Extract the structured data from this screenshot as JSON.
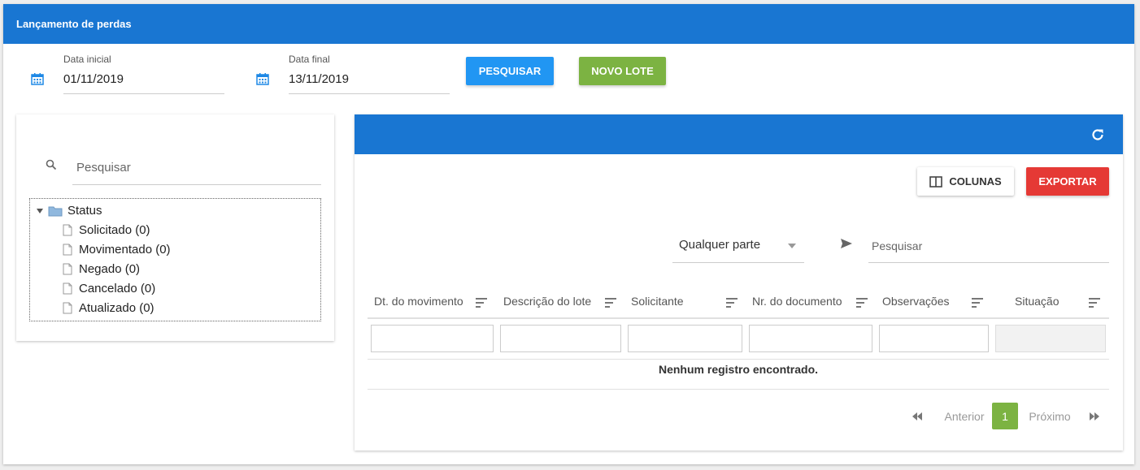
{
  "title": "Lançamento de perdas",
  "date_start": {
    "label": "Data inicial",
    "value": "01/11/2019",
    "icon": "calendar-icon"
  },
  "date_end": {
    "label": "Data final",
    "value": "13/11/2019",
    "icon": "calendar-icon"
  },
  "buttons": {
    "search": "PESQUISAR",
    "new_batch": "NOVO LOTE",
    "columns": "COLUNAS",
    "export": "EXPORTAR"
  },
  "tree_panel": {
    "search_placeholder": "Pesquisar",
    "root": "Status",
    "items": [
      "Solicitado (0)",
      "Movimentado (0)",
      "Negado (0)",
      "Cancelado (0)",
      "Atualizado (0)"
    ]
  },
  "grid": {
    "filter_mode": "Qualquer parte",
    "search_placeholder": "Pesquisar",
    "columns": [
      "Dt. do movimento",
      "Descrição do lote",
      "Solicitante",
      "Nr. do documento",
      "Observações",
      "Situação"
    ],
    "empty_message": "Nenhum registro encontrado.",
    "pager": {
      "prev": "Anterior",
      "next": "Próximo",
      "current": "1"
    }
  },
  "colors": {
    "primary": "#1976d2",
    "search_button": "#2196f3",
    "new_button": "#7cb342",
    "export_button": "#e53935"
  }
}
